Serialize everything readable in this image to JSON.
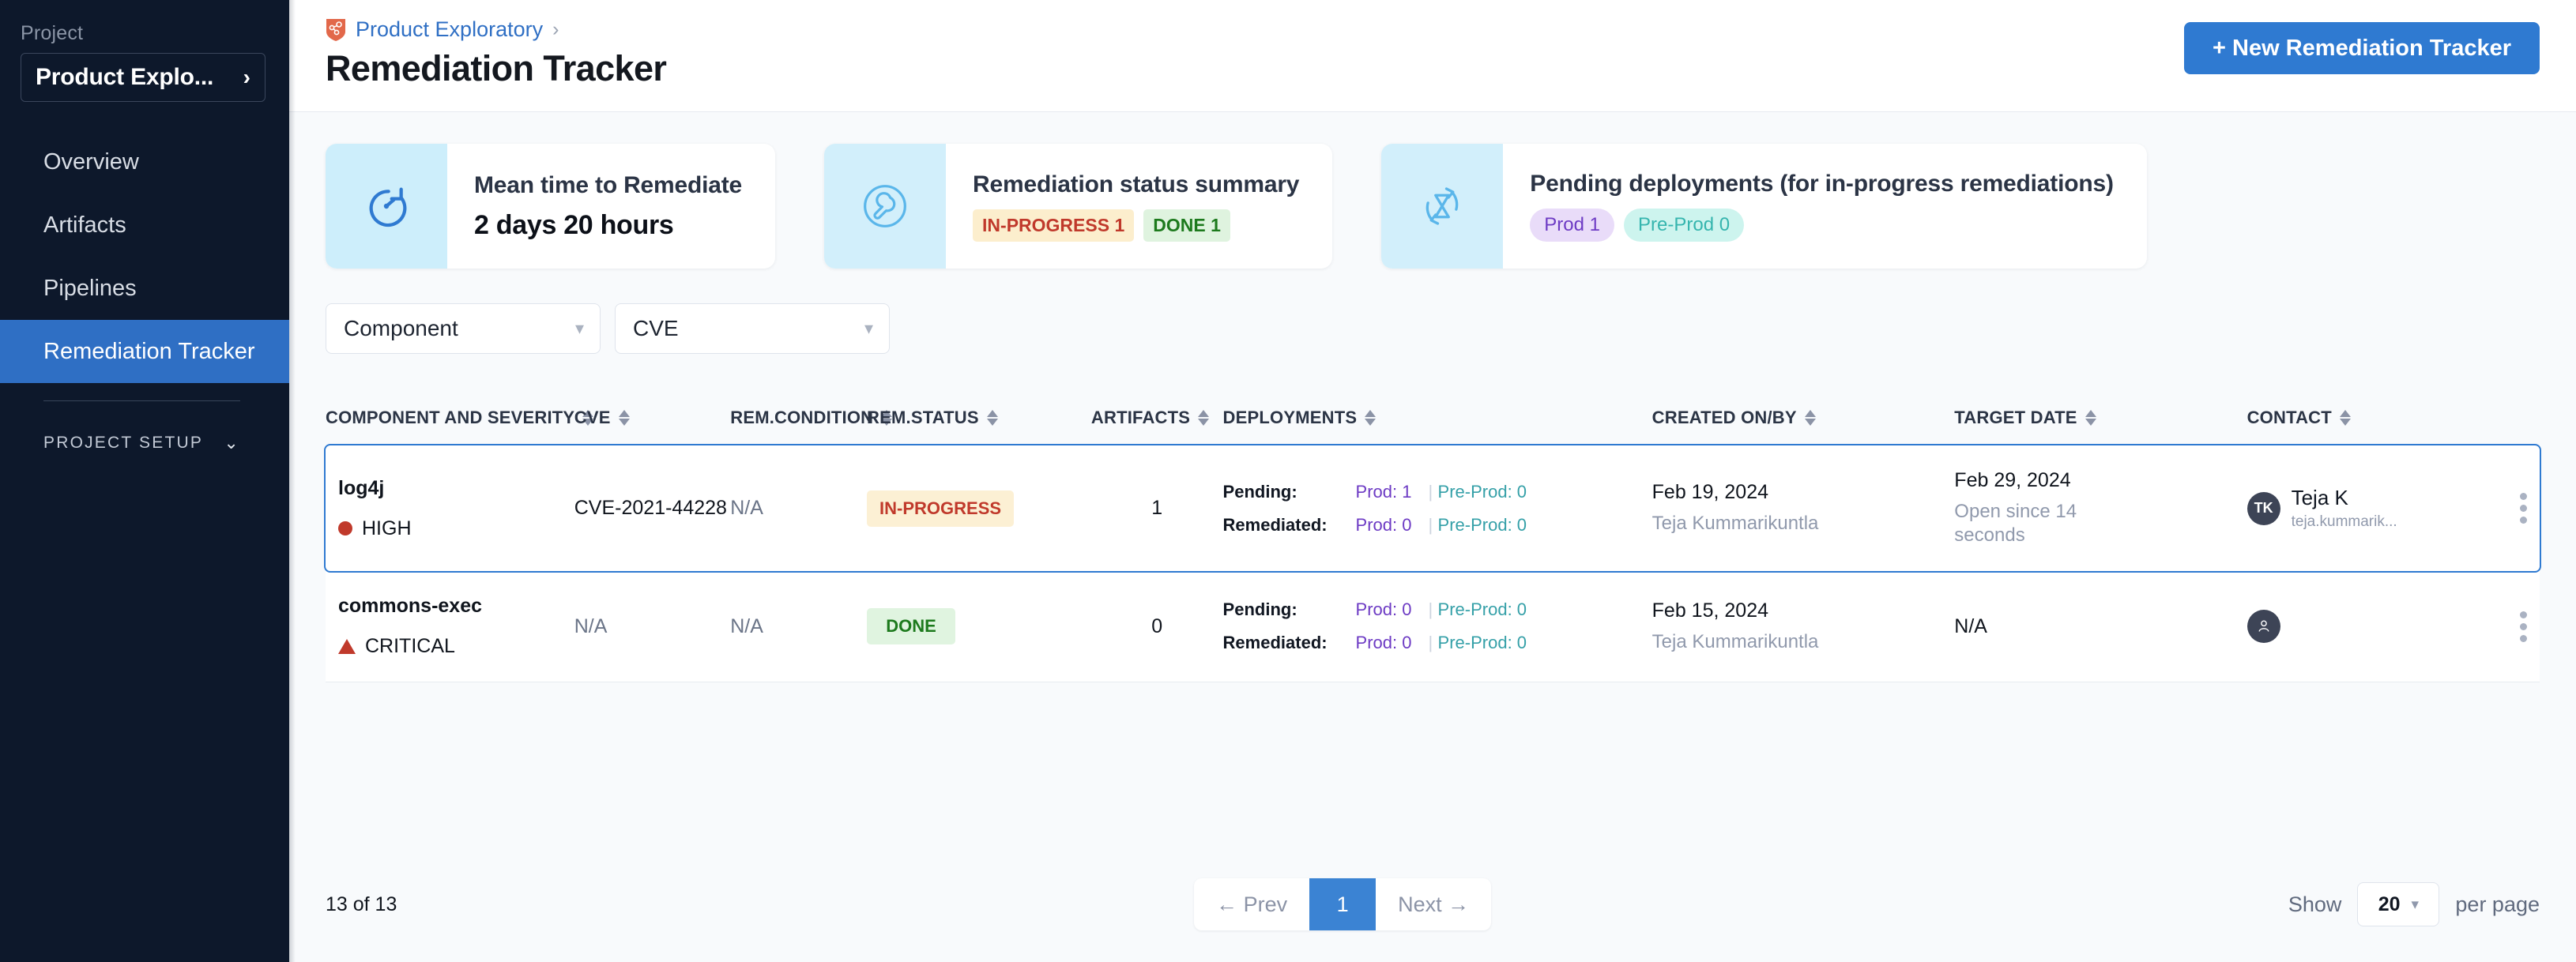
{
  "sidebar": {
    "project_label": "Project",
    "project_name": "Product Explo...",
    "project_chevron": "›",
    "items": [
      {
        "label": "Overview"
      },
      {
        "label": "Artifacts"
      },
      {
        "label": "Pipelines"
      },
      {
        "label": "Remediation Tracker"
      }
    ],
    "setup_label": "PROJECT SETUP",
    "setup_chevron": "⌄"
  },
  "header": {
    "breadcrumb_link": "Product Exploratory",
    "breadcrumb_sep": "›",
    "page_title": "Remediation Tracker",
    "new_button": "+ New Remediation Tracker"
  },
  "cards": [
    {
      "icon": "stopwatch-icon",
      "title": "Mean time to Remediate",
      "value": "2 days 20 hours"
    },
    {
      "icon": "wrench-icon",
      "title": "Remediation status summary",
      "pills": [
        {
          "label": "IN-PROGRESS 1",
          "kind": "inprog"
        },
        {
          "label": "DONE 1",
          "kind": "done"
        }
      ]
    },
    {
      "icon": "hourglass-refresh-icon",
      "title": "Pending deployments (for in-progress remediations)",
      "pills": [
        {
          "label": "Prod 1",
          "kind": "prod"
        },
        {
          "label": "Pre-Prod 0",
          "kind": "preprod"
        }
      ]
    }
  ],
  "filters": [
    {
      "value": "Component",
      "name": "component-filter"
    },
    {
      "value": "CVE",
      "name": "cve-filter"
    }
  ],
  "table": {
    "columns": [
      "COMPONENT AND SEVERITY",
      "CVE",
      "REM.CONDITION",
      "REM.STATUS",
      "ARTIFACTS",
      "DEPLOYMENTS",
      "CREATED ON/BY",
      "TARGET DATE",
      "CONTACT"
    ],
    "rows": [
      {
        "component": "log4j",
        "severity": "HIGH",
        "severity_icon": "circle-dot-icon",
        "cve": "CVE-2021-44228",
        "rem_condition": "N/A",
        "rem_status": "IN-PROGRESS",
        "rem_status_kind": "inprog",
        "artifacts": "1",
        "deployments": {
          "pending_label": "Pending:",
          "pending_prod": "Prod: 1",
          "pending_preprod": "Pre-Prod: 0",
          "remediated_label": "Remediated:",
          "remediated_prod": "Prod: 0",
          "remediated_preprod": "Pre-Prod: 0",
          "separator": "|"
        },
        "created_on": "Feb 19, 2024",
        "created_by": "Teja Kummarikuntla",
        "target_date": "Feb 29, 2024",
        "target_sub": "Open since 14 seconds",
        "contact_initials": "TK",
        "contact_name": "Teja K",
        "contact_email": "teja.kummarik..."
      },
      {
        "component": "commons-exec",
        "severity": "CRITICAL",
        "severity_icon": "warning-triangle-icon",
        "cve": "N/A",
        "rem_condition": "N/A",
        "rem_status": "DONE",
        "rem_status_kind": "done",
        "artifacts": "0",
        "deployments": {
          "pending_label": "Pending:",
          "pending_prod": "Prod: 0",
          "pending_preprod": "Pre-Prod: 0",
          "remediated_label": "Remediated:",
          "remediated_prod": "Prod: 0",
          "remediated_preprod": "Pre-Prod: 0",
          "separator": "|"
        },
        "created_on": "Feb 15, 2024",
        "created_by": "Teja Kummarikuntla",
        "target_date": "N/A",
        "target_sub": "",
        "contact_initials": "",
        "contact_name": "",
        "contact_email": ""
      }
    ]
  },
  "footer": {
    "count": "13 of 13",
    "prev": "← Prev",
    "current_page": "1",
    "next": "Next →",
    "show_label": "Show",
    "page_size": "20",
    "page_size_chevron": "⌄",
    "per_page_label": "per page"
  },
  "colors": {
    "accent": "#2f7ad1",
    "sidebar_bg": "#0d182b",
    "critical": "#c0392b",
    "high": "#c0392b",
    "done_green": "#1d7a1d",
    "prod_purple": "#6d3bc4",
    "preprod_teal": "#35b5ae"
  }
}
